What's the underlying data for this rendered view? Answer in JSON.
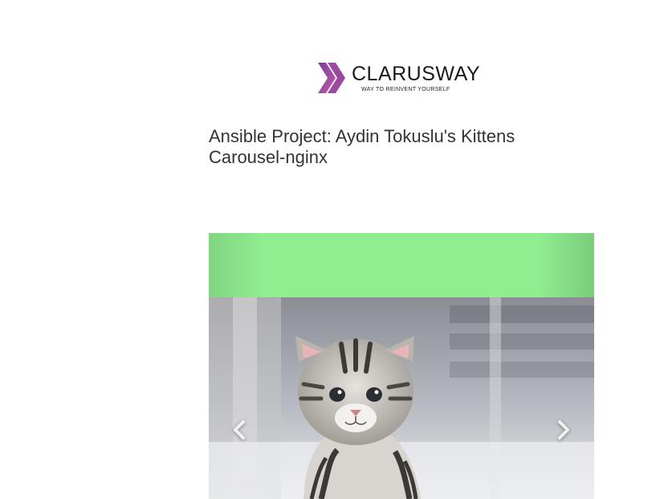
{
  "logo": {
    "wordmark": "CLARUSWAY",
    "tagline": "WAY TO REINVENT YOURSELF",
    "icon": "chevron-arrows-logo-icon",
    "colors": [
      "#7b3f98",
      "#b0579f"
    ]
  },
  "page": {
    "title": "Ansible Project: Aydin Tokuslu's Kittens Carousel-nginx"
  },
  "carousel": {
    "band_color": "#90ee90",
    "slide_image": "kitten-photo",
    "prev_icon": "chevron-left-icon",
    "next_icon": "chevron-right-icon"
  }
}
